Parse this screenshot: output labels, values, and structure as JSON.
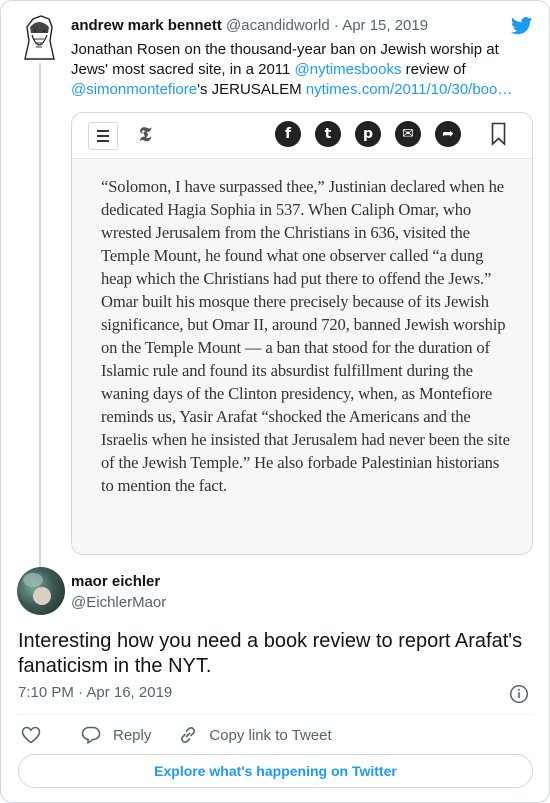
{
  "parent_tweet": {
    "author_name": "andrew mark bennett",
    "handle": "@acandidworld",
    "separator": "·",
    "date": "Apr 15, 2019",
    "text_parts": [
      {
        "text": "Jonathan Rosen on the thousand-year ban on Jewish worship at Jews' most sacred site, in a 2011 ",
        "link": false
      },
      {
        "text": "@nytimesbooks",
        "link": true
      },
      {
        "text": " review of ",
        "link": false
      },
      {
        "text": "@simonmontefiore",
        "link": true
      },
      {
        "text": "'s JERUSALEM ",
        "link": false
      },
      {
        "text": "nytimes.com/2011/10/30/boo…",
        "link": true
      }
    ]
  },
  "embed": {
    "logo": "𝕿",
    "share_icons": [
      {
        "name": "facebook-icon",
        "glyph": "f"
      },
      {
        "name": "twitter-share-icon",
        "glyph": "t"
      },
      {
        "name": "pinterest-icon",
        "glyph": "p"
      },
      {
        "name": "email-icon",
        "glyph": "✉"
      },
      {
        "name": "share-arrow-icon",
        "glyph": "➦"
      }
    ],
    "quote": "“Solomon, I have surpassed thee,” Justinian declared when he dedicated Hagia Sophia in 537. When Caliph Omar, who wrested Jerusalem from the Christians in 636, visited the Temple Mount, he found what one observer called “a dung heap which the Christians had put there to offend the Jews.” Omar built his mosque there precisely because of its Jewish significance, but Omar II, around 720, banned Jewish worship on the Temple Mount — a ban that stood for the duration of Islamic rule and found its absurdist fulfillment during the waning days of the Clinton presidency, when, as Montefiore reminds us, Yasir Arafat “shocked the Americans and the Israelis when he insisted that Jerusalem had never been the site of the Jewish Temple.” He also forbade Palestinian historians to mention the fact."
  },
  "reply_tweet": {
    "author_name": "maor eichler",
    "handle": "@EichlerMaor",
    "text": "Interesting how you need a book review to report Arafat's fanaticism in the NYT.",
    "timestamp": "7:10 PM · Apr 16, 2019"
  },
  "actions": {
    "reply_label": "Reply",
    "copy_link_label": "Copy link to Tweet"
  },
  "explore_label": "Explore what's happening on Twitter",
  "colors": {
    "accent": "#1d9bf0",
    "text": "#0f1419",
    "secondary": "#536471",
    "border": "#cfd9de"
  }
}
